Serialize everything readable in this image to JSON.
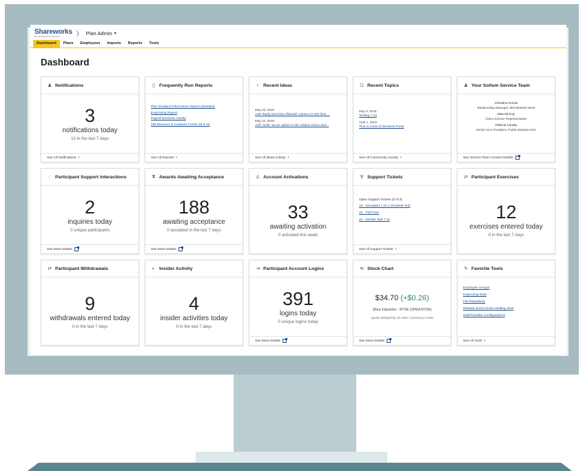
{
  "header": {
    "brand": "Shareworks",
    "brand_sub": "BY MORGAN STANLEY",
    "separator": "〉",
    "context": "Plan Admin",
    "context_caret": "▾",
    "tabs": [
      {
        "label": "Dashboard",
        "active": true
      },
      {
        "label": "Plans",
        "active": false
      },
      {
        "label": "Employees",
        "active": false
      },
      {
        "label": "Imports",
        "active": false
      },
      {
        "label": "Reports",
        "active": false
      },
      {
        "label": "Tools",
        "active": false
      }
    ]
  },
  "page_title": "Dashboard",
  "cards": {
    "notifications": {
      "icon": "bell-icon",
      "glyph": "♟",
      "title": "Notifications",
      "number": "3",
      "label": "notifications today",
      "sub": "10 in the last 7 days",
      "footer": "See All Notifications"
    },
    "frequent_reports": {
      "icon": "document-icon",
      "glyph": "▯",
      "title": "Frequently Run Reports",
      "links": [
        "Plan Dividend Information Report (Detailed)",
        "Expensing Report",
        "Payroll Services Activity",
        "HM Revenue & Customs Forms 35 & 42"
      ],
      "footer": "See All Reports"
    },
    "recent_ideas": {
      "icon": "lightbulb-icon",
      "glyph": "♀",
      "title": "Recent Ideas",
      "items": [
        {
          "date": "May 22, 2019",
          "link": "Add \"Early Exercise Allowed\" column to ISO limit ..."
        },
        {
          "date": "May 22, 2019",
          "link": "Add \"units\" as an option in the subject menu and..."
        }
      ],
      "footer": "See All Ideas Activity"
    },
    "recent_topics": {
      "icon": "list-icon",
      "glyph": "☷",
      "title": "Recent Topics",
      "items": [
        {
          "date": "May 6, 2019",
          "link": "Testing 7.10"
        },
        {
          "date": "April 1, 2019",
          "link": "This is a test of Zendesk Posts"
        }
      ],
      "footer": "See All Community Activity"
    },
    "service_team": {
      "icon": "person-icon",
      "glyph": "♟",
      "title": "Your Sollum Service Team",
      "members": [
        {
          "name": "Christine Purvie",
          "role": "Relationship Manager, Mid-Markets West"
        },
        {
          "name": "Max McCoy",
          "role": "Client Service Representative"
        },
        {
          "name": "Patricia Landry",
          "role": "Senior Vice President, Public Markets USA"
        }
      ],
      "footer": "See Service Team Contact Details"
    },
    "support_interactions": {
      "icon": "headset-icon",
      "glyph": "◌",
      "title": "Participant Support Interactions",
      "number": "2",
      "label": "inquiries today",
      "sub": "0 unique participants",
      "footer": "See More Details"
    },
    "awards": {
      "icon": "hourglass-icon",
      "glyph": "⧗",
      "title": "Awards Awaiting Acceptance",
      "number": "188",
      "label": "awaiting acceptance",
      "sub": "0 accepted in the last 7 days",
      "footer": "See More Details"
    },
    "activations": {
      "icon": "user-plus-icon",
      "glyph": "♙",
      "title": "Account Activations",
      "number": "33",
      "label": "awaiting activation",
      "sub": "0 activated this week",
      "footer": ""
    },
    "support_tickets": {
      "icon": "ticket-icon",
      "glyph": "∀",
      "title": "Support Tickets",
      "intro": "Open Support Tickets (3 of 3)",
      "links": [
        "10 - Emulated 7.10.1 Zendesk Test",
        "22 - PGP test",
        "21 - Smoke Test 7.11"
      ],
      "footer": "See All Support Tickets"
    },
    "exercises": {
      "icon": "transfer-icon",
      "glyph": "⇄",
      "title": "Participant Exercises",
      "number": "12",
      "label": "exercises entered today",
      "sub": "0 in the last 7 days",
      "footer": ""
    },
    "withdrawals": {
      "icon": "transfer-icon",
      "glyph": "⇄",
      "title": "Participant Withdrawals",
      "number": "9",
      "label": "withdrawals entered today",
      "sub": "0 in the last 7 days",
      "footer": ""
    },
    "insider": {
      "icon": "info-icon",
      "glyph": "◐",
      "title": "Insider Activity",
      "number": "4",
      "label": "insider activities today",
      "sub": "0 in the last 7 days",
      "footer": ""
    },
    "logins": {
      "icon": "login-icon",
      "glyph": "⇥",
      "title": "Participant Account Logins",
      "number": "391",
      "label": "logins today",
      "sub": "0 unique logins today",
      "footer": "See More Details"
    },
    "stock": {
      "icon": "chart-icon",
      "glyph": "≋",
      "title": "Stock Chart",
      "price": "$34.70",
      "change": "(+$0.26)",
      "company": "Shea Industries - NYSE (SHEA NYSE)",
      "note": "Quote delayed by 15 mins; Currency in USD",
      "footer": "See More Details"
    },
    "favorite_tools": {
      "icon": "wrench-icon",
      "glyph": "✎",
      "title": "Favorite Tools",
      "links": [
        "Employee Groups",
        "Expensing Data",
        "File Repository",
        "Release Event Grant Vesting View",
        "Sale/Transfer Configurations"
      ],
      "footer": "See All Tools"
    }
  }
}
